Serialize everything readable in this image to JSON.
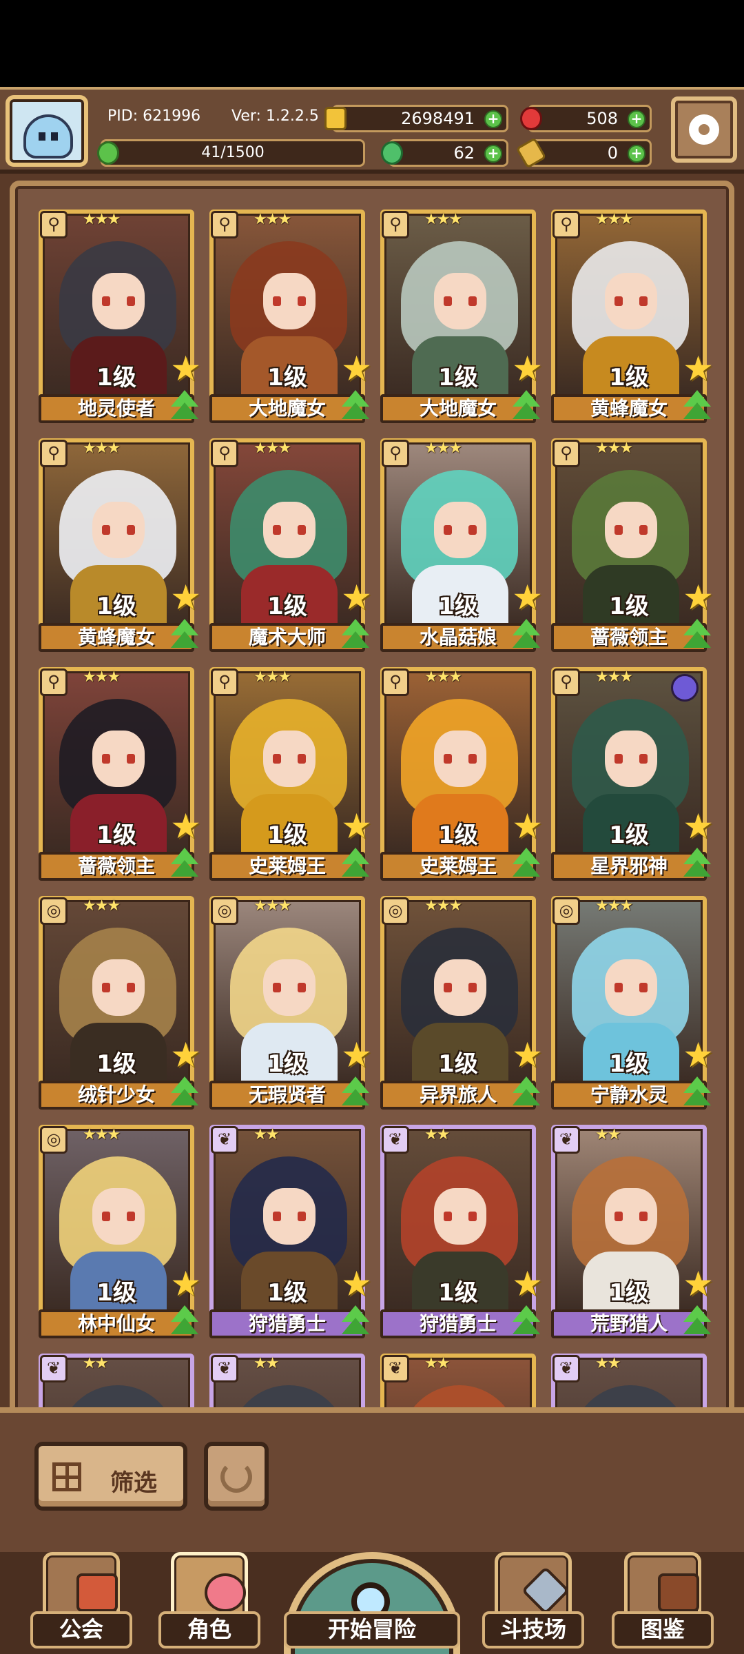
{
  "hud": {
    "pid": "PID: 621996",
    "version": "Ver: 1.2.2.5",
    "gold": "2698491",
    "gems": "508",
    "energy": "41/1500",
    "clover": "62",
    "tickets": "0"
  },
  "cards": [
    {
      "name": "地灵使者",
      "level": "1级",
      "rank": "★★★",
      "icon": "magnifier-icon",
      "frame": "gold",
      "hair": "#3a3a44",
      "outfit": "#5b1b1b"
    },
    {
      "name": "大地魔女",
      "level": "1级",
      "rank": "★★★",
      "icon": "magnifier-icon",
      "frame": "gold",
      "hair": "#8a3a1e",
      "outfit": "#a4582a"
    },
    {
      "name": "大地魔女",
      "level": "1级",
      "rank": "★★★",
      "icon": "magnifier-icon",
      "frame": "gold",
      "hair": "#b9c9bf",
      "outfit": "#4f6b52"
    },
    {
      "name": "黄蜂魔女",
      "level": "1级",
      "rank": "★★★",
      "icon": "magnifier-icon",
      "frame": "gold",
      "hair": "#e9e9ea",
      "outfit": "#c78a1f"
    },
    {
      "name": "黄蜂魔女",
      "level": "1级",
      "rank": "★★★",
      "icon": "magnifier-icon",
      "frame": "gold",
      "hair": "#eef1f5",
      "outfit": "#b98a2a"
    },
    {
      "name": "魔术大师",
      "level": "1级",
      "rank": "★★★",
      "icon": "magnifier-icon",
      "frame": "gold",
      "hair": "#3d8c6b",
      "outfit": "#9a2a2a"
    },
    {
      "name": "水晶菇娘",
      "level": "1级",
      "rank": "★★★",
      "icon": "magnifier-icon",
      "frame": "gold",
      "hair": "#5fd3bf",
      "outfit": "#e8eef4"
    },
    {
      "name": "蔷薇领主",
      "level": "1级",
      "rank": "★★★",
      "icon": "magnifier-icon",
      "frame": "gold",
      "hair": "#5a7a3a",
      "outfit": "#2f3a24"
    },
    {
      "name": "蔷薇领主",
      "level": "1级",
      "rank": "★★★",
      "icon": "magnifier-icon",
      "frame": "gold",
      "hair": "#1f1c24",
      "outfit": "#8a1f2a"
    },
    {
      "name": "史莱姆王",
      "level": "1级",
      "rank": "★★★",
      "icon": "magnifier-icon",
      "frame": "gold",
      "hair": "#e8b12b",
      "outfit": "#d59a1c"
    },
    {
      "name": "史莱姆王",
      "level": "1级",
      "rank": "★★★",
      "icon": "magnifier-icon",
      "frame": "gold",
      "hair": "#f1a427",
      "outfit": "#e07a1c"
    },
    {
      "name": "星界邪神",
      "level": "1级",
      "rank": "★★★",
      "icon": "magnifier-icon",
      "frame": "gold",
      "hair": "#2f5a4a",
      "outfit": "#234a3c",
      "orb": true
    },
    {
      "name": "绒针少女",
      "level": "1级",
      "rank": "★★★",
      "icon": "target-icon",
      "frame": "gold",
      "hair": "#a5824a",
      "outfit": "#3a2d22"
    },
    {
      "name": "无瑕贤者",
      "level": "1级",
      "rank": "★★★",
      "icon": "target-icon",
      "frame": "gold",
      "hair": "#f2d68a",
      "outfit": "#dfe9f2"
    },
    {
      "name": "异界旅人",
      "level": "1级",
      "rank": "★★★",
      "icon": "target-icon",
      "frame": "gold",
      "hair": "#2a2f3a",
      "outfit": "#5a4a2a"
    },
    {
      "name": "宁静水灵",
      "level": "1级",
      "rank": "★★★",
      "icon": "target-icon",
      "frame": "gold",
      "hair": "#8fd6ea",
      "outfit": "#6ec3dc"
    },
    {
      "name": "林中仙女",
      "level": "1级",
      "rank": "★★★",
      "icon": "target-icon",
      "frame": "gold",
      "hair": "#f0d27a",
      "outfit": "#5a7ab0"
    },
    {
      "name": "狩猎勇士",
      "level": "1级",
      "rank": "★★",
      "icon": "feather-icon",
      "frame": "purple",
      "hair": "#232a4a",
      "outfit": "#6a4a2a"
    },
    {
      "name": "狩猎勇士",
      "level": "1级",
      "rank": "★★",
      "icon": "feather-icon",
      "frame": "purple",
      "hair": "#b2432a",
      "outfit": "#3a3a2a"
    },
    {
      "name": "荒野猎人",
      "level": "1级",
      "rank": "★★",
      "icon": "feather-icon",
      "frame": "purple",
      "hair": "#b8703a",
      "outfit": "#e9e4dc"
    },
    {
      "name": "",
      "level": "",
      "rank": "★★",
      "icon": "feather-icon",
      "frame": "purple",
      "hair": "#3a3f4a",
      "outfit": "#3a3f4a"
    },
    {
      "name": "",
      "level": "",
      "rank": "★★",
      "icon": "feather-icon",
      "frame": "purple",
      "hair": "#3a3f4a",
      "outfit": "#3a3f4a"
    },
    {
      "name": "",
      "level": "",
      "rank": "★★",
      "icon": "feather-icon",
      "frame": "gold",
      "hair": "#b0502a",
      "outfit": "#b0502a"
    },
    {
      "name": "",
      "level": "",
      "rank": "★★",
      "icon": "feather-icon",
      "frame": "purple",
      "hair": "#3a3f4a",
      "outfit": "#3a3f4a"
    }
  ],
  "toolbar": {
    "filter_label": "筛选"
  },
  "nav": {
    "guild": "公会",
    "character": "角色",
    "start": "开始冒险",
    "arena": "斗技场",
    "codex": "图鉴"
  },
  "colors": {
    "gold_frame": "#e5b651",
    "purple_frame": "#c8a5e6",
    "plus_green": "#5cc24a",
    "panel_brown": "#6b4a35"
  }
}
